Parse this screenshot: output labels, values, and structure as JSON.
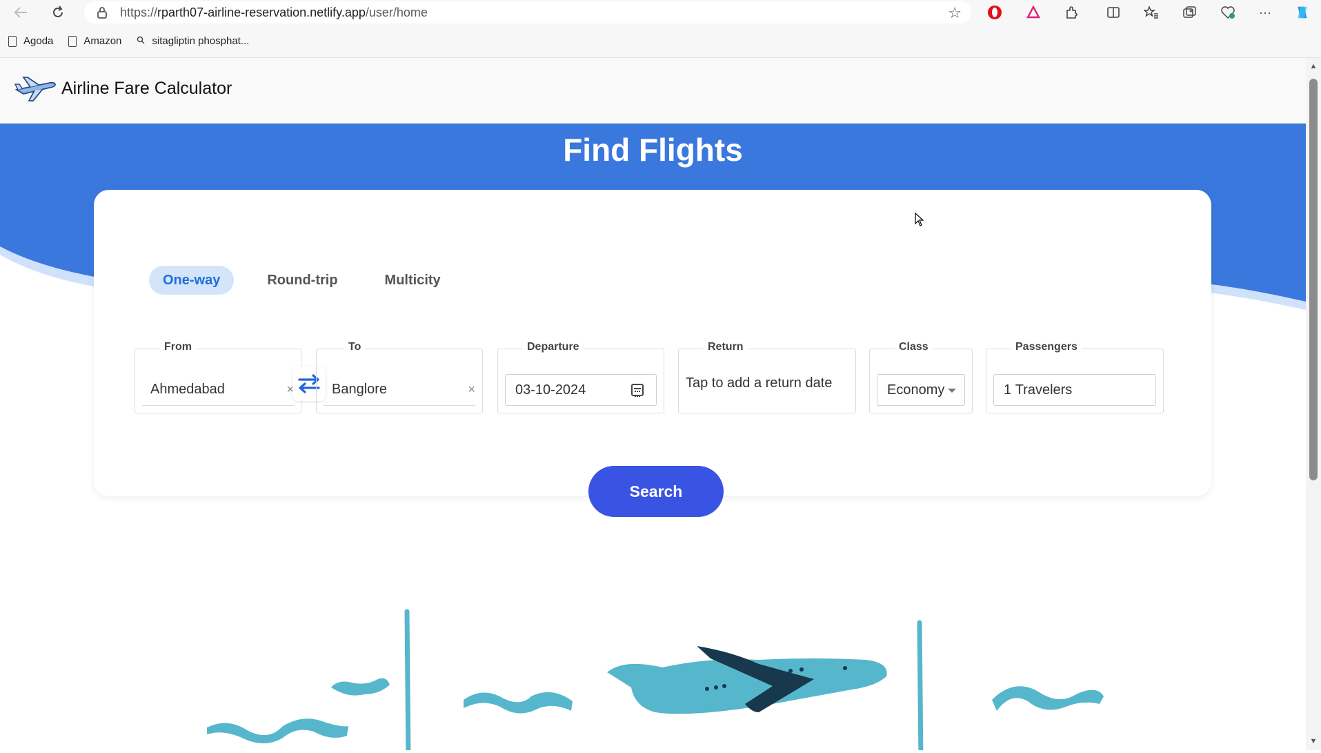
{
  "browser": {
    "url_prefix": "https://",
    "url_domain": "rparth07-airline-reservation.netlify.app",
    "url_path": "/user/home",
    "bookmarks": [
      {
        "label": "Agoda",
        "icon": "page-icon"
      },
      {
        "label": "Amazon",
        "icon": "page-icon"
      },
      {
        "label": "sitagliptin phosphat...",
        "icon": "search-icon"
      }
    ]
  },
  "app": {
    "title": "Airline Fare Calculator",
    "logo": "airplane-logo-icon"
  },
  "hero": {
    "title": "Find Flights",
    "color": "#3b78de"
  },
  "trip_tabs": [
    {
      "label": "One-way",
      "active": true
    },
    {
      "label": "Round-trip",
      "active": false
    },
    {
      "label": "Multicity",
      "active": false
    }
  ],
  "form": {
    "from": {
      "label": "From",
      "value": "Ahmedabad"
    },
    "to": {
      "label": "To",
      "value": "Banglore"
    },
    "departure": {
      "label": "Departure",
      "value": "03-10-2024"
    },
    "return": {
      "label": "Return",
      "placeholder": "Tap to add a return date"
    },
    "class": {
      "label": "Class",
      "value": "Economy"
    },
    "passengers": {
      "label": "Passengers",
      "count": "1",
      "unit": "Travelers"
    },
    "search_label": "Search"
  },
  "colors": {
    "accent": "#3954e3",
    "tab_active_bg": "#d4e5fb",
    "tab_active_text": "#1f6fd9",
    "illustration_teal": "#56b6cb",
    "illustration_dark": "#18384d"
  }
}
